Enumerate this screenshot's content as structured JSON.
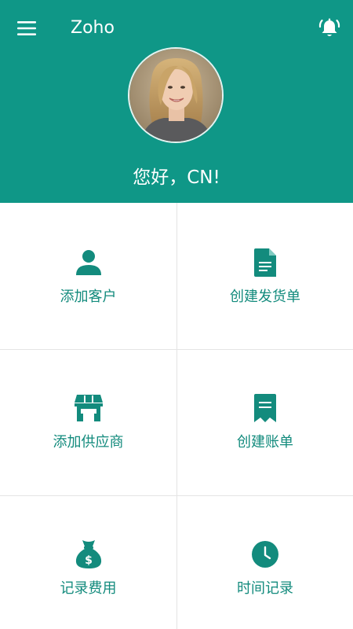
{
  "header": {
    "app_title": "Zoho",
    "greeting": "您好，CN!",
    "menu_icon": "hamburger-menu-icon",
    "alarm_icon": "alarm-bell-icon"
  },
  "colors": {
    "primary": "#0f9787",
    "accent_text": "#138b7d",
    "background": "#ffffff",
    "divider": "#e4e4e4"
  },
  "tiles": [
    {
      "label": "添加客户",
      "icon": "person-icon"
    },
    {
      "label": "创建发货单",
      "icon": "document-icon"
    },
    {
      "label": "添加供应商",
      "icon": "storefront-icon"
    },
    {
      "label": "创建账单",
      "icon": "receipt-icon"
    },
    {
      "label": "记录费用",
      "icon": "money-bag-icon"
    },
    {
      "label": "时间记录",
      "icon": "clock-icon"
    }
  ]
}
